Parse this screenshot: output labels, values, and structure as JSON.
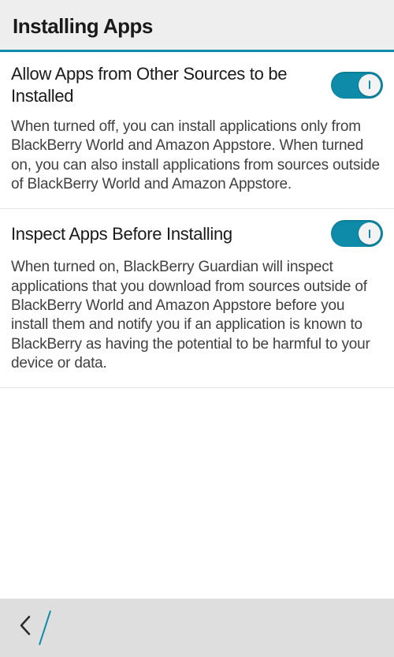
{
  "header": {
    "title": "Installing Apps"
  },
  "sections": [
    {
      "title": "Allow Apps from Other Sources to be Installed",
      "toggle_on": true,
      "description": "When turned off, you can install applications only from BlackBerry World and Amazon Appstore. When turned on, you can also install applications from sources outside of BlackBerry World and Amazon Appstore."
    },
    {
      "title": "Inspect Apps Before Installing",
      "toggle_on": true,
      "description": "When turned on, BlackBerry Guardian will inspect applications that you download from sources outside of BlackBerry World and Amazon Appstore before you install them and notify you if an application is known to BlackBerry as having the potential to be harmful to your device or data."
    }
  ]
}
